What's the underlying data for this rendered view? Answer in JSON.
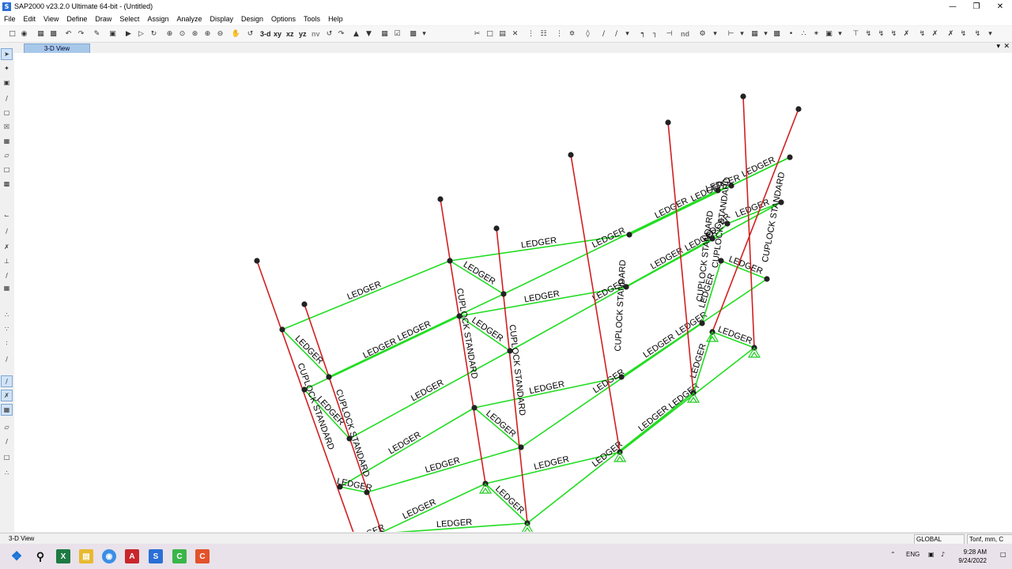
{
  "app": {
    "title": "SAP2000 v23.2.0 Ultimate 64-bit - (Untitled)",
    "icon_letter": "S"
  },
  "menu": [
    "File",
    "Edit",
    "View",
    "Define",
    "Draw",
    "Select",
    "Assign",
    "Analyze",
    "Display",
    "Design",
    "Options",
    "Tools",
    "Help"
  ],
  "toolbar": {
    "view_labels": [
      "3-d",
      "xy",
      "xz",
      "yz",
      "nv"
    ],
    "nd_label": "nd"
  },
  "tab": {
    "label": "3-D View"
  },
  "structure": {
    "standard_label": "CUPLOCK STANDARD",
    "ledger_label": "LEDGER",
    "colors": {
      "standard": "#d12020",
      "ledger": "#22dd22",
      "joint": "#222222",
      "support": "#22cc22"
    }
  },
  "status": {
    "view_label": "3-D View",
    "coord_system": "GLOBAL",
    "units": "Tonf, mm, C"
  },
  "taskbar": {
    "time": "9:28 AM",
    "date": "9/24/2022",
    "lang": "ENG"
  }
}
